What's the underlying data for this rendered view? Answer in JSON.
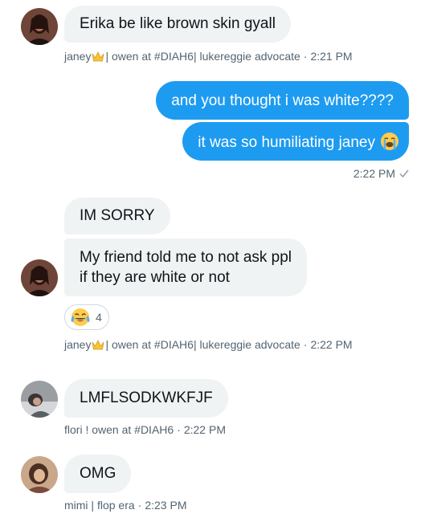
{
  "messages": {
    "m1": {
      "text": "Erika be like brown skin gyall"
    },
    "meta1": {
      "name_a": "janey",
      "name_b": "| owen at #DIAH6| lukereggie advocate",
      "time": "2:21 PM"
    },
    "out1": {
      "text": "and you thought i was white????"
    },
    "out2": {
      "text": "it was so humiliating janey"
    },
    "out_meta": {
      "time": "2:22 PM"
    },
    "m2": {
      "text": "IM SORRY"
    },
    "m3": {
      "line1": "My friend told me to not ask ppl",
      "line2": "if they are white or not"
    },
    "reaction": {
      "emoji": "tears-of-joy",
      "count": "4"
    },
    "meta2": {
      "name_a": "janey",
      "name_b": "| owen at #DIAH6| lukereggie advocate",
      "time": "2:22 PM"
    },
    "m4": {
      "text": "LMFLSODKWKFJF"
    },
    "meta3": {
      "name": "flori ! owen at #DIAH6",
      "time": "2:22 PM"
    },
    "m5": {
      "text": "OMG"
    },
    "meta4": {
      "name": "mimi | flop era",
      "time": "2:23 PM"
    }
  },
  "colors": {
    "outgoing": "#1d9bf0",
    "incoming": "#eff3f4",
    "meta": "#536471"
  }
}
